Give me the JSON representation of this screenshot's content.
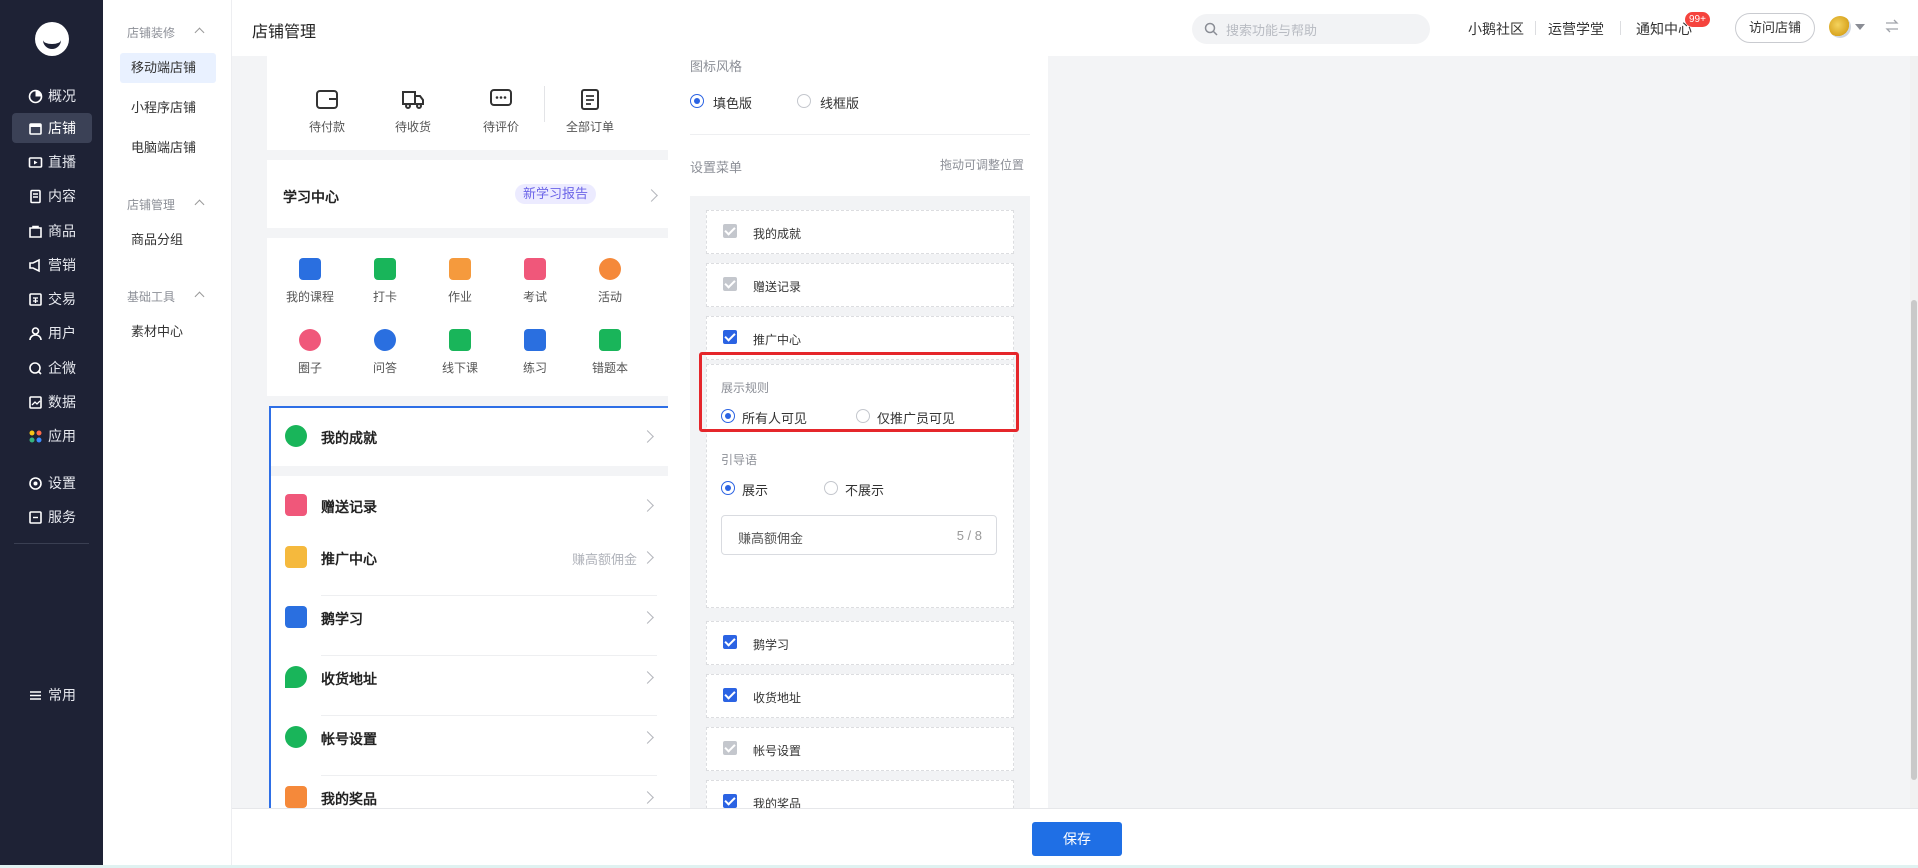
{
  "nav": {
    "items": [
      {
        "label": "概况",
        "icon": "overview-icon"
      },
      {
        "label": "店铺",
        "icon": "store-icon",
        "active": true
      },
      {
        "label": "直播",
        "icon": "live-icon"
      },
      {
        "label": "内容",
        "icon": "content-icon"
      },
      {
        "label": "商品",
        "icon": "goods-icon"
      },
      {
        "label": "营销",
        "icon": "marketing-icon"
      },
      {
        "label": "交易",
        "icon": "trade-icon"
      },
      {
        "label": "用户",
        "icon": "user-icon"
      },
      {
        "label": "企微",
        "icon": "wecom-icon"
      },
      {
        "label": "数据",
        "icon": "data-icon"
      },
      {
        "label": "应用",
        "icon": "apps-icon"
      },
      {
        "label": "设置",
        "icon": "settings-icon"
      },
      {
        "label": "服务",
        "icon": "service-icon"
      }
    ],
    "bottom": "常用"
  },
  "subnav": {
    "groups": [
      {
        "title": "店铺装修",
        "items": [
          "移动端店铺",
          "小程序店铺",
          "电脑端店铺"
        ]
      },
      {
        "title": "店铺管理",
        "items": [
          "商品分组"
        ]
      },
      {
        "title": "基础工具",
        "items": [
          "素材中心"
        ]
      }
    ]
  },
  "header": {
    "title": "店铺管理",
    "search_placeholder": "搜索功能与帮助",
    "links": [
      "小鹅社区",
      "运营学堂",
      "通知中心"
    ],
    "notify_badge": "99+",
    "visit_label": "访问店铺"
  },
  "phone": {
    "orders": [
      "待付款",
      "待收货",
      "待评价",
      "全部订单"
    ],
    "learn_title": "学习中心",
    "learn_badge": "新学习报告",
    "grid": [
      "我的课程",
      "打卡",
      "作业",
      "考试",
      "活动",
      "圈子",
      "问答",
      "线下课",
      "练习",
      "错题本"
    ],
    "menu": [
      {
        "label": "我的成就",
        "extra": ""
      },
      {
        "label": "赠送记录",
        "extra": ""
      },
      {
        "label": "推广中心",
        "extra": "赚高额佣金"
      },
      {
        "label": "鹅学习",
        "extra": ""
      },
      {
        "label": "收货地址",
        "extra": ""
      },
      {
        "label": "帐号设置",
        "extra": ""
      },
      {
        "label": "我的奖品",
        "extra": ""
      }
    ]
  },
  "settings": {
    "icon_style_label": "图标风格",
    "icon_style_options": [
      "填色版",
      "线框版"
    ],
    "icon_style_selected": "填色版",
    "menu_label": "设置菜单",
    "drag_hint": "拖动可调整位置",
    "menu_items": [
      {
        "label": "我的成就",
        "checked": true,
        "locked": true
      },
      {
        "label": "赠送记录",
        "checked": true,
        "locked": true
      },
      {
        "label": "推广中心",
        "checked": true,
        "locked": false
      },
      {
        "label": "鹅学习",
        "checked": true,
        "locked": false
      },
      {
        "label": "收货地址",
        "checked": true,
        "locked": false
      },
      {
        "label": "帐号设置",
        "checked": true,
        "locked": true
      },
      {
        "label": "我的奖品",
        "checked": true,
        "locked": false
      }
    ],
    "rule_label": "展示规则",
    "rule_options": [
      "所有人可见",
      "仅推广员可见"
    ],
    "rule_selected": "所有人可见",
    "guide_label": "引导语",
    "guide_options": [
      "展示",
      "不展示"
    ],
    "guide_selected": "展示",
    "guide_value": "赚高额佣金",
    "guide_count": "5 / 8"
  },
  "footer": {
    "save_label": "保存"
  },
  "colors": {
    "accent": "#1f6fe5",
    "highlight": "#e5262b",
    "sidebar": "#1e2235"
  }
}
